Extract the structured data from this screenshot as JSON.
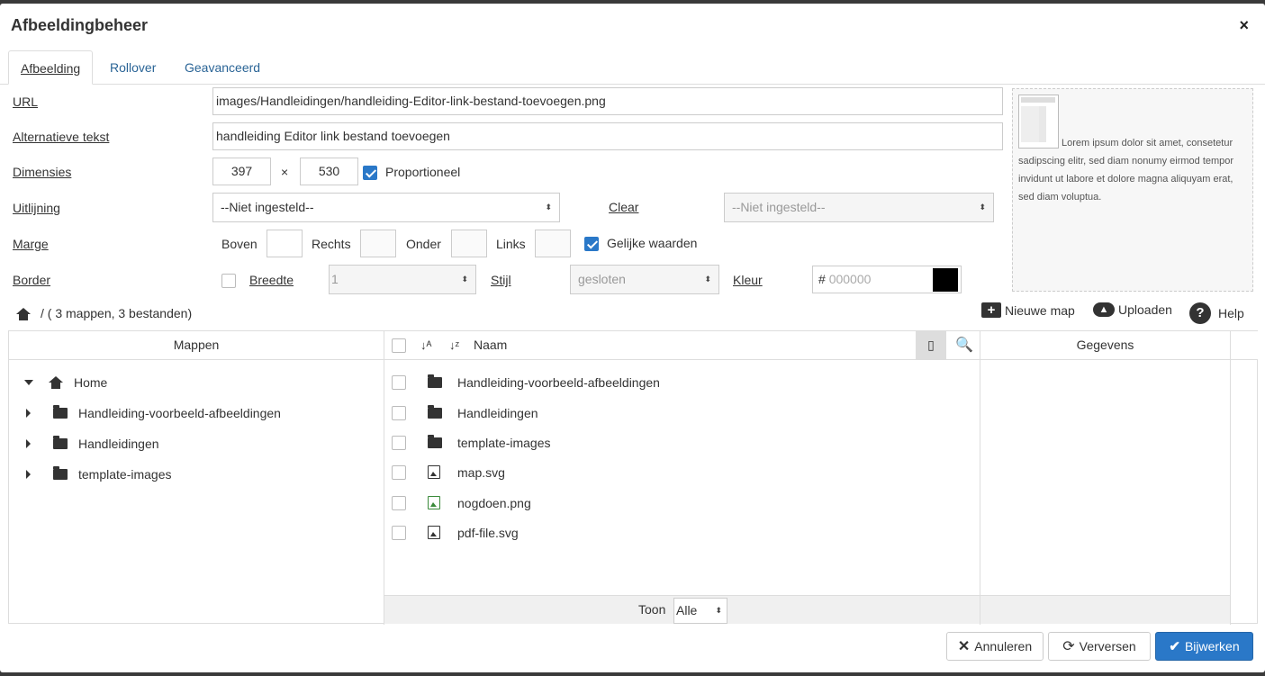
{
  "dialog": {
    "title": "Afbeeldingbeheer",
    "close": "×"
  },
  "tabs": [
    "Afbeelding",
    "Rollover",
    "Geavanceerd"
  ],
  "form": {
    "url_label": "URL",
    "url_value": "images/Handleidingen/handleiding-Editor-link-bestand-toevoegen.png",
    "alt_label": "Alternatieve tekst",
    "alt_value": "handleiding Editor link bestand toevoegen",
    "dim_label": "Dimensies",
    "width": "397",
    "times": "×",
    "height": "530",
    "proportional": "Proportioneel",
    "align_label": "Uitlijning",
    "align_value": "--Niet ingesteld--",
    "clear_label": "Clear",
    "clear_value": "--Niet ingesteld--",
    "margin_label": "Marge",
    "top": "Boven",
    "right": "Rechts",
    "bottom": "Onder",
    "left": "Links",
    "equal": "Gelijke waarden",
    "border_label": "Border",
    "border_width_label": "Breedte",
    "border_width_value": "1",
    "style_label": "Stijl",
    "style_value": "gesloten",
    "color_label": "Kleur",
    "color_hash": "#",
    "color_value": "000000",
    "color_swatch": "#000000"
  },
  "preview_text": "Lorem ipsum dolor sit amet, consetetur sadipscing elitr, sed diam nonumy eirmod tempor invidunt ut labore et dolore magna aliquyam erat, sed diam voluptua.",
  "browser": {
    "path": "/ ( 3 mappen, 3 bestanden)",
    "new_folder": "Nieuwe map",
    "upload": "Uploaden",
    "help": "Help",
    "folders_header": "Mappen",
    "name_header": "Naam",
    "details_header": "Gegevens",
    "show_label": "Toon",
    "show_value": "Alle",
    "tree": [
      {
        "label": "Home",
        "expanded": true
      },
      {
        "label": "Handleiding-voorbeeld-afbeeldingen"
      },
      {
        "label": "Handleidingen"
      },
      {
        "label": "template-images"
      }
    ],
    "files": [
      {
        "name": "Handleiding-voorbeeld-afbeeldingen",
        "type": "folder"
      },
      {
        "name": "Handleidingen",
        "type": "folder"
      },
      {
        "name": "template-images",
        "type": "folder"
      },
      {
        "name": "map.svg",
        "type": "image"
      },
      {
        "name": "nogdoen.png",
        "type": "image-green"
      },
      {
        "name": "pdf-file.svg",
        "type": "image"
      }
    ]
  },
  "buttons": {
    "cancel": "Annuleren",
    "refresh": "Verversen",
    "update": "Bijwerken"
  },
  "colors": {
    "primary": "#2a78c8",
    "link": "#2a6496"
  }
}
